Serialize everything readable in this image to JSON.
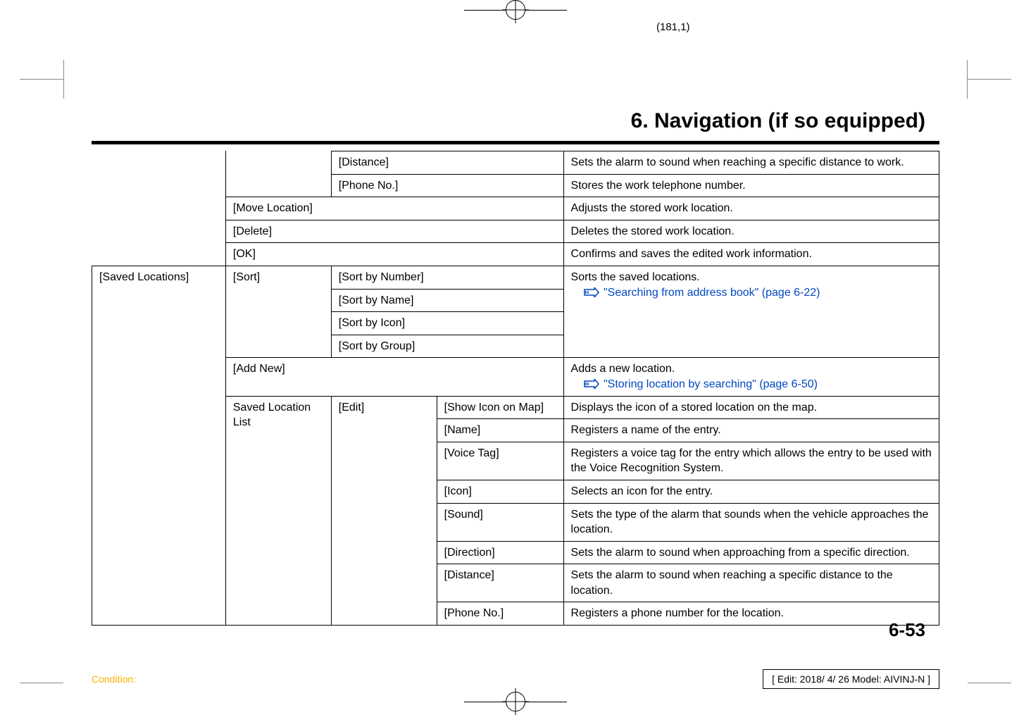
{
  "coord": "(181,1)",
  "chapter": "6. Navigation (if so equipped)",
  "table": {
    "r1c3": "[Distance]",
    "r1c4": "Sets the alarm to sound when reaching a specific distance to work.",
    "r2c3": "[Phone No.]",
    "r2c4": "Stores the work telephone number.",
    "r3c2": "[Move Location]",
    "r3c4": "Adjusts the stored work location.",
    "r4c2": "[Delete]",
    "r4c4": "Deletes the stored work location.",
    "r5c2": "[OK]",
    "r5c4": "Confirms and saves the edited work information.",
    "r6c1": "[Saved Locations]",
    "r6c2": "[Sort]",
    "r6c3": "[Sort by Number]",
    "r6c4a": "Sorts the saved locations.",
    "r6ref": "\"Searching from address book\" (page 6-22)",
    "r7c3": "[Sort by Name]",
    "r8c3": "[Sort by Icon]",
    "r9c3": "[Sort by Group]",
    "r10c2": "[Add New]",
    "r10c4a": "Adds a new location.",
    "r10ref": "\"Storing location by searching\" (page 6-50)",
    "r11c2": "Saved Location List",
    "r11c3": "[Edit]",
    "r11c3b": "[Show Icon on Map]",
    "r11c4": "Displays the icon of a stored location on the map.",
    "r12c3b": "[Name]",
    "r12c4": "Registers a name of the entry.",
    "r13c3b": "[Voice Tag]",
    "r13c4": "Registers a voice tag for the entry which allows the entry to be used with the Voice Recognition System.",
    "r14c3b": "[Icon]",
    "r14c4": "Selects an icon for the entry.",
    "r15c3b": "[Sound]",
    "r15c4": "Sets the type of the alarm that sounds when the vehicle approaches the location.",
    "r16c3b": "[Direction]",
    "r16c4": "Sets the alarm to sound when approaching from a specific direction.",
    "r17c3b": "[Distance]",
    "r17c4": "Sets the alarm to sound when reaching a specific distance to the location.",
    "r18c3b": "[Phone No.]",
    "r18c4": "Registers a phone number for the location."
  },
  "pageNum": "6-53",
  "condition": "Condition:",
  "editBox": "[ Edit: 2018/ 4/ 26   Model: AIVINJ-N ]"
}
